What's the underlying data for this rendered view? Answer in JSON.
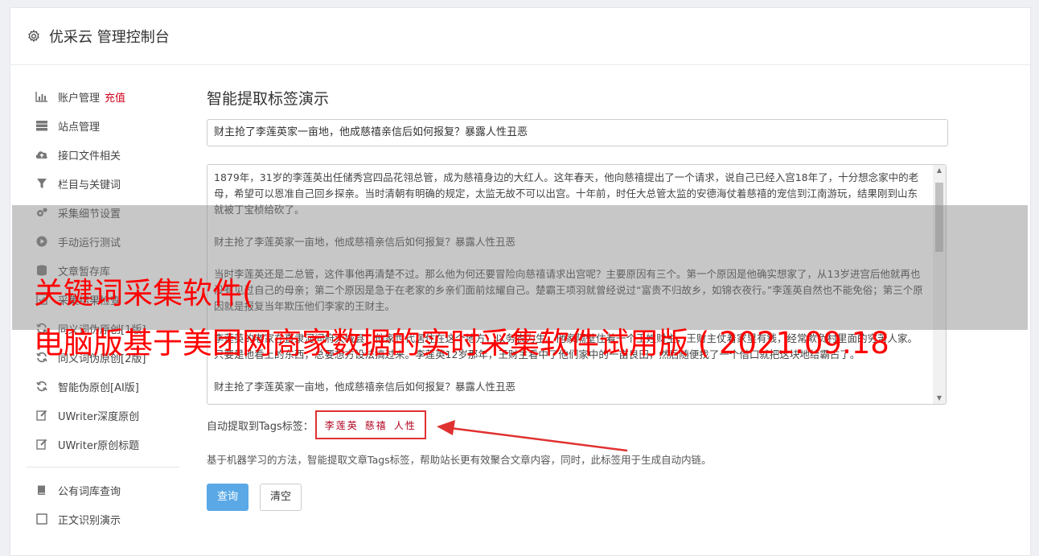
{
  "header": {
    "title": "优采云 管理控制台",
    "icon": "gear-icon"
  },
  "sidebar": {
    "items": [
      {
        "label": "账户管理",
        "badge": "充值",
        "icon": "bar-chart-icon"
      },
      {
        "label": "站点管理",
        "icon": "server-icon"
      },
      {
        "label": "接口文件相关",
        "icon": "cloud-upload-icon"
      },
      {
        "label": "栏目与关键词",
        "icon": "filter-icon"
      },
      {
        "label": "采集细节设置",
        "icon": "cogs-icon"
      },
      {
        "label": "手动运行测试",
        "icon": "play-icon"
      },
      {
        "label": "文章暂存库",
        "icon": "database-icon"
      },
      {
        "label": "采集结果检查",
        "icon": "check-icon"
      },
      {
        "label": "同义词伪原创[1版]",
        "icon": "refresh-icon"
      },
      {
        "label": "同义词伪原创[2版]",
        "icon": "refresh-icon"
      },
      {
        "label": "智能伪原创[AI版]",
        "icon": "refresh-icon"
      },
      {
        "label": "UWriter深度原创",
        "icon": "edit-icon"
      },
      {
        "label": "UWriter原创标题",
        "icon": "edit-icon"
      }
    ],
    "items2": [
      {
        "label": "公有词库查询",
        "icon": "book-icon"
      },
      {
        "label": "正文识别演示",
        "icon": "square-icon"
      }
    ]
  },
  "main": {
    "heading": "智能提取标签演示",
    "title_value": "财主抢了李莲英家一亩地，他成慈禧亲信后如何报复？暴露人性丑恶",
    "content_paragraphs": [
      "1879年，31岁的李莲英出任储秀宫四品花翎总管，成为慈禧身边的大红人。这年春天，他向慈禧提出了一个请求，说自己已经入宫18年了，十分想念家中的老母，希望可以恩准自己回乡探亲。当时清朝有明确的规定，太监无故不可以出宫。十年前，时任大总管太监的安德海仗着慈禧的宠信到江南游玩，结果刚到山东就被丁宝桢给砍了。",
      "财主抢了李莲英家一亩地，他成慈禧亲信后如何报复？暴露人性丑恶",
      "当时李莲英还是二总管，这件事他再清楚不过。那么他为何还要冒险向慈禧请求出宫呢？主要原因有三个。第一个原因是他确实想家了，从13岁进宫后他就再也没有见过自己的母亲；第二个原因是急于在老家的乡亲们面前炫耀自己。楚霸王项羽就曾经说过“富贵不归故乡，如锦衣夜行。”李莲英自然也不能免俗；第三个原因就是报复当年欺压他们李家的王财主。",
      "李莲英的老家在直隶河间府大城县，他家世代居住在这个地方，以务农为生。他家隔壁住着一个王姓财主，王财主仗着家里有钱，经常欺负村里面的穷苦人家。只要是他看上的东西，总要想方设法搞过来。李莲英12岁那年，王财主看中了他们家中的一亩良田，然后随便找了一个借口就把这块地给霸占了。",
      "财主抢了李莲英家一亩地，他成慈禧亲信后如何报复？暴露人性丑恶"
    ],
    "tags_label": "自动提取到Tags标签：",
    "tags": [
      "李莲英",
      "慈禧",
      "人性"
    ],
    "description": "基于机器学习的方法，智能提取文章Tags标签，帮助站长更有效聚合文章内容，同时，此标签用于生成自动内链。",
    "query_button": "查询",
    "clear_button": "清空"
  },
  "overlay": {
    "line1": "关键词采集软件(",
    "line2": "电脑版基于美团网商家数据的实时采集软件试用版 ( 2021.09.18"
  },
  "colors": {
    "accent": "#5aa9e6",
    "badge": "#d0021b",
    "tag": "#b00020",
    "overlay_text": "#ff0000",
    "highlight_box": "#e03131"
  }
}
